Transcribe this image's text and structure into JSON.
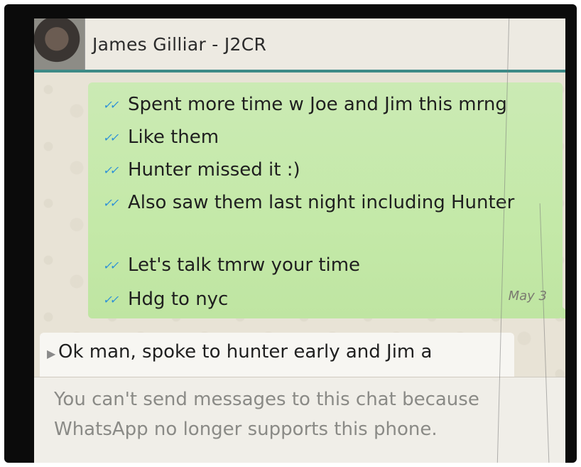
{
  "header": {
    "contact_name": "James Gilliar - J2CR"
  },
  "outgoing_messages": [
    {
      "text": "Spent more time w Joe and Jim this mrng",
      "status_icon": "double-check-icon"
    },
    {
      "text": "Like them",
      "status_icon": "double-check-icon"
    },
    {
      "text": "Hunter missed it :)",
      "status_icon": "double-check-icon"
    },
    {
      "text": "Also saw them last night including Hunter",
      "status_icon": "double-check-icon"
    },
    {
      "text": "Let's talk tmrw your time",
      "status_icon": "double-check-icon"
    },
    {
      "text": "Hdg to nyc",
      "status_icon": "double-check-icon"
    }
  ],
  "outgoing_date": "May 3",
  "incoming_message": {
    "text": "Ok man, spoke to hunter early and Jim a"
  },
  "notice": {
    "line1": "You can't send messages to this chat because",
    "line2": "WhatsApp no longer supports this phone."
  },
  "colors": {
    "header_accent": "#3d8a86",
    "outgoing_bubble": "#c4e9a8",
    "read_tick": "#2a8fd8"
  }
}
